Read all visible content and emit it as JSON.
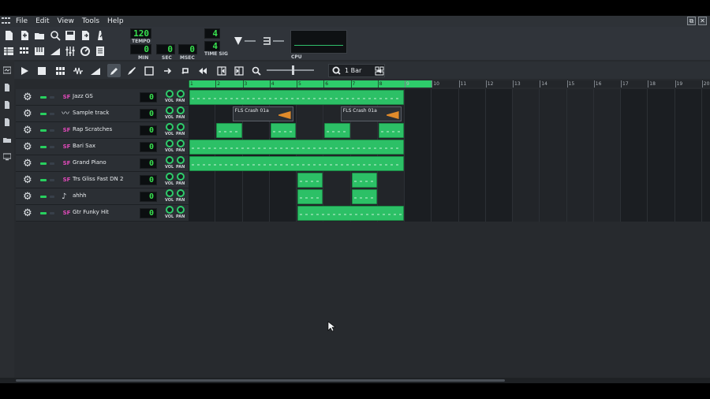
{
  "menubar": {
    "items": [
      "File",
      "Edit",
      "View",
      "Tools",
      "Help"
    ],
    "window_buttons": [
      "⧉",
      "✕"
    ]
  },
  "toolbar": {
    "tempo_value": "120",
    "tempo_label": "TEMPO",
    "min_value": "0",
    "min_label": "MIN",
    "sec_value": "0",
    "sec_label": "SEC",
    "msec_value": "0",
    "msec_label": "MSEC",
    "timesig_num": "4",
    "timesig_den": "4",
    "timesig_label": "TIME SIG",
    "cpu_label": "CPU"
  },
  "song_editor": {
    "quantize_label": "1 Bar"
  },
  "timeline": {
    "bars": [
      "1",
      "2",
      "3",
      "4",
      "5",
      "6",
      "7",
      "8",
      "9",
      "10",
      "11",
      "12",
      "13",
      "14",
      "15",
      "16",
      "17",
      "18",
      "19",
      "20"
    ],
    "loop_end_bar": 9
  },
  "tracks": [
    {
      "name": "Jazz GS",
      "type": "instrument",
      "value": "0",
      "vol_label": "VOL",
      "pan_label": "PAN"
    },
    {
      "name": "Sample track",
      "type": "sample",
      "value": "0",
      "vol_label": "VOL",
      "pan_label": "PAN",
      "clips": [
        "FLS Crash 01a",
        "FLS Crash 01a"
      ]
    },
    {
      "name": "Rap Scratches",
      "type": "instrument",
      "value": "0",
      "vol_label": "VOL",
      "pan_label": "PAN"
    },
    {
      "name": "Bari Sax",
      "type": "instrument",
      "value": "0",
      "vol_label": "VOL",
      "pan_label": "PAN"
    },
    {
      "name": "Grand Piano",
      "type": "instrument",
      "value": "0",
      "vol_label": "VOL",
      "pan_label": "PAN"
    },
    {
      "name": "Trs Gliss Fast DN 2",
      "type": "instrument",
      "value": "0",
      "vol_label": "VOL",
      "pan_label": "PAN"
    },
    {
      "name": "ahhh",
      "type": "audiofile",
      "value": "0",
      "vol_label": "VOL",
      "pan_label": "PAN"
    },
    {
      "name": "Gtr Funky Hit",
      "type": "instrument",
      "value": "0",
      "vol_label": "VOL",
      "pan_label": "PAN"
    }
  ],
  "colors": {
    "accent": "#2ecc6b",
    "lcd_text": "#38e04f",
    "instrument_icon": "#e04ab9",
    "sample_wave": "#e08a2a"
  }
}
